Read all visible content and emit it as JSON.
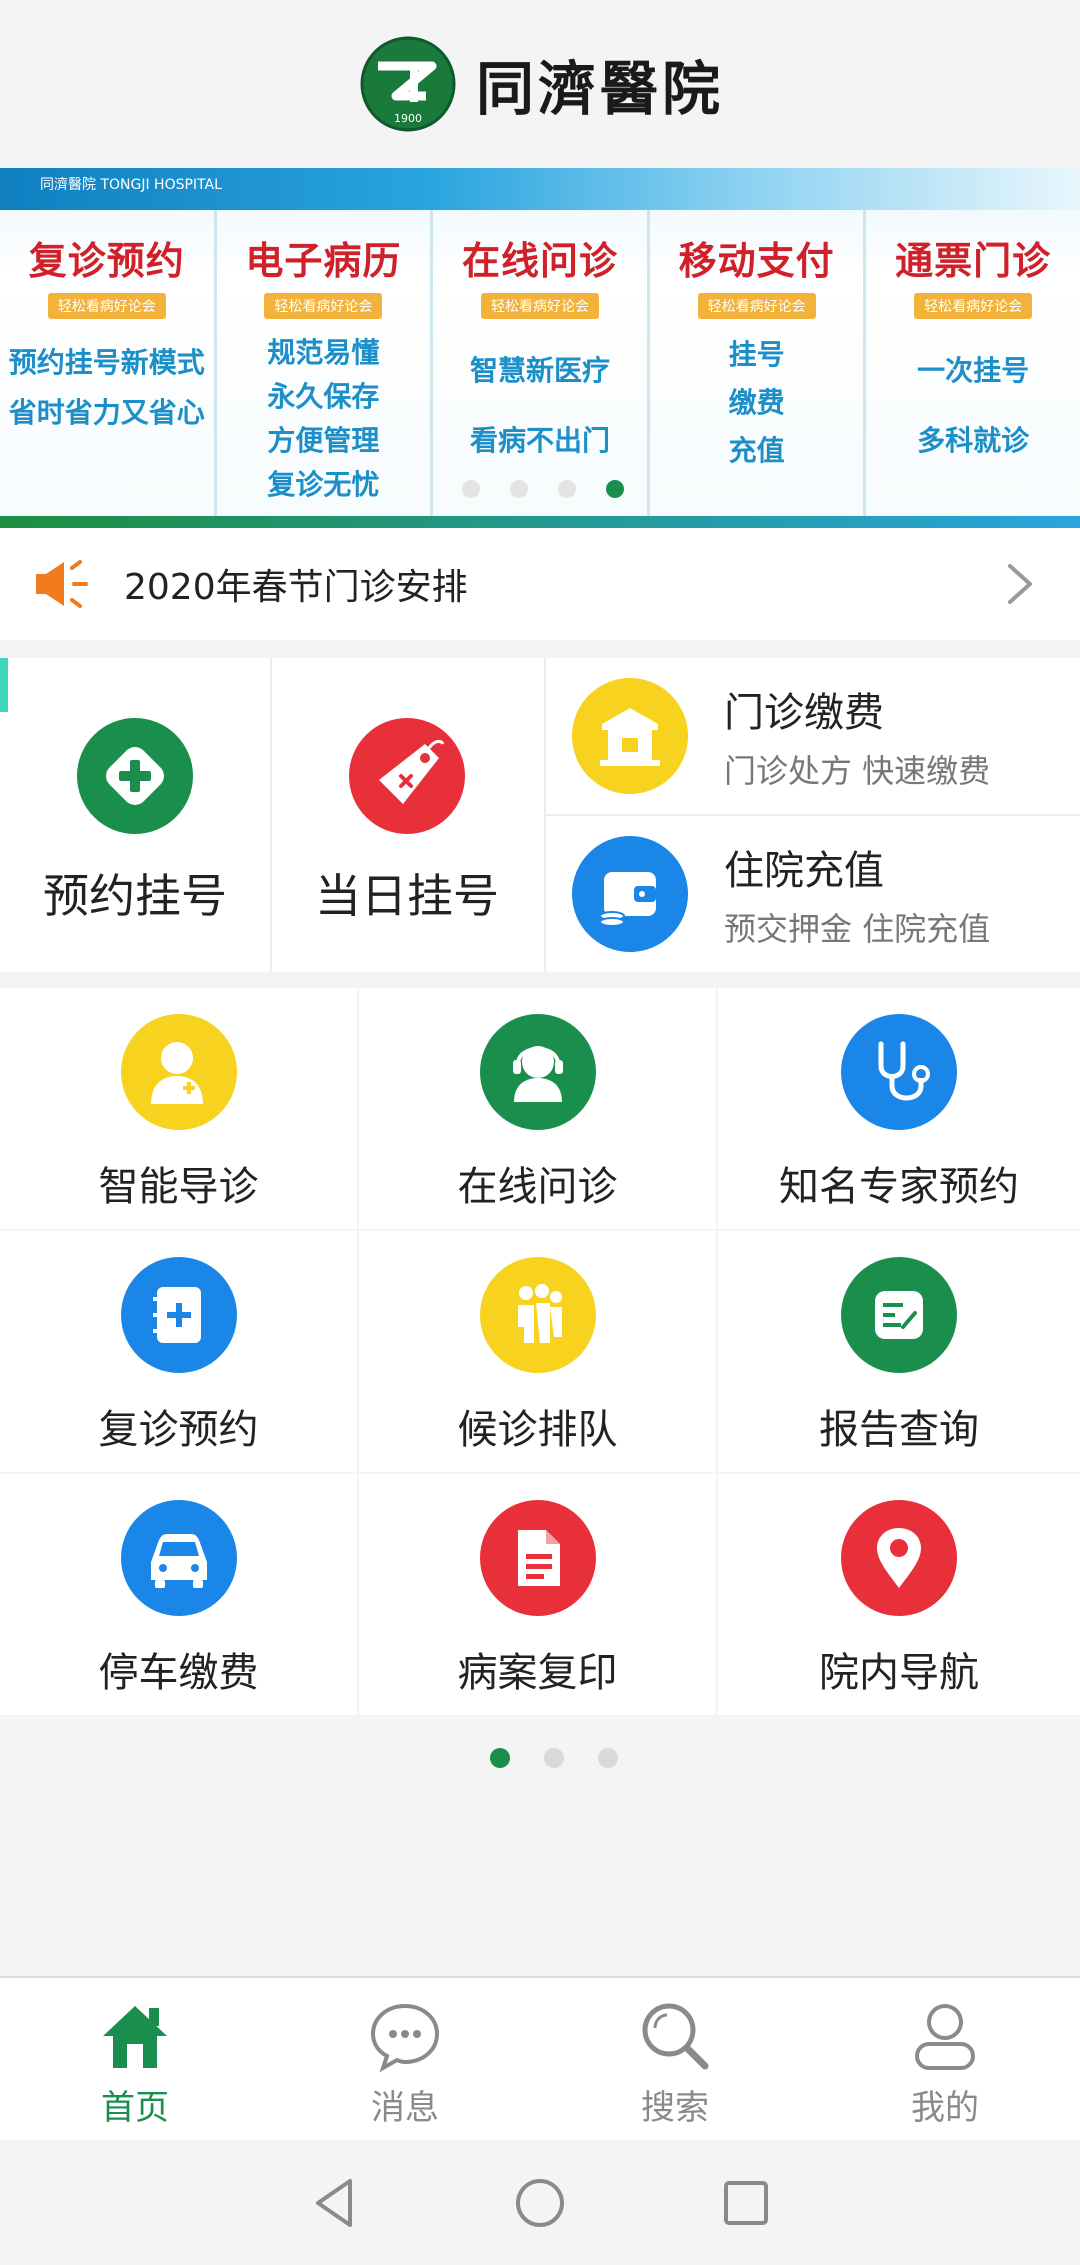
{
  "header": {
    "logo_text": "同濟醫院",
    "logo_year": "1900"
  },
  "banner": {
    "brand": "同濟醫院 TONGJI HOSPITAL",
    "columns": [
      {
        "title": "复诊预约",
        "tag": "轻松看病好论会",
        "lines": [
          "预约挂号新模式",
          "省时省力又省心"
        ]
      },
      {
        "title": "电子病历",
        "tag": "轻松看病好论会",
        "lines": [
          "规范易懂",
          "永久保存",
          "方便管理",
          "复诊无忧"
        ]
      },
      {
        "title": "在线问诊",
        "tag": "轻松看病好论会",
        "lines": [
          "智慧新医疗",
          "看病不出门"
        ]
      },
      {
        "title": "移动支付",
        "tag": "轻松看病好论会",
        "lines": [
          "挂号",
          "缴费",
          "充值"
        ]
      },
      {
        "title": "通票门诊",
        "tag": "轻松看病好论会",
        "lines": [
          "一次挂号",
          "多科就诊"
        ]
      }
    ],
    "active_dot": 3,
    "dot_count": 4
  },
  "notice": {
    "text": "2020年春节门诊安排",
    "icon": "megaphone-icon"
  },
  "quick": {
    "appointment": {
      "label": "预约挂号",
      "icon": "medical-plus-icon",
      "color": "#1a8f4d"
    },
    "same_day": {
      "label": "当日挂号",
      "icon": "tag-icon",
      "color": "#e8303a"
    },
    "payment": {
      "title": "门诊缴费",
      "subtitle": "门诊处方 快速缴费",
      "icon": "building-icon",
      "color": "#f7d21e"
    },
    "recharge": {
      "title": "住院充值",
      "subtitle": "预交押金 住院充值",
      "icon": "wallet-icon",
      "color": "#1a86e8"
    }
  },
  "services": [
    {
      "label": "智能导诊",
      "icon": "doctor-icon",
      "color": "#f7d21e"
    },
    {
      "label": "在线问诊",
      "icon": "headset-icon",
      "color": "#1a8f4d"
    },
    {
      "label": "知名专家预约",
      "icon": "stethoscope-icon",
      "color": "#1a86e8"
    },
    {
      "label": "复诊预约",
      "icon": "notebook-plus-icon",
      "color": "#1a86e8"
    },
    {
      "label": "候诊排队",
      "icon": "people-queue-icon",
      "color": "#f7d21e"
    },
    {
      "label": "报告查询",
      "icon": "report-icon",
      "color": "#1a8f4d"
    },
    {
      "label": "停车缴费",
      "icon": "car-icon",
      "color": "#1a86e8"
    },
    {
      "label": "病案复印",
      "icon": "document-icon",
      "color": "#e8303a"
    },
    {
      "label": "院内导航",
      "icon": "location-pin-icon",
      "color": "#e8303a"
    }
  ],
  "grid_pages": {
    "count": 3,
    "active": 0
  },
  "tabbar": {
    "items": [
      {
        "label": "首页",
        "icon": "home-icon",
        "active": true
      },
      {
        "label": "消息",
        "icon": "message-icon",
        "active": false
      },
      {
        "label": "搜索",
        "icon": "search-icon",
        "active": false
      },
      {
        "label": "我的",
        "icon": "user-icon",
        "active": false
      }
    ]
  },
  "colors": {
    "brand_green": "#1a8f4d",
    "blue": "#1a86e8",
    "yellow": "#f7d21e",
    "red": "#e8303a"
  }
}
